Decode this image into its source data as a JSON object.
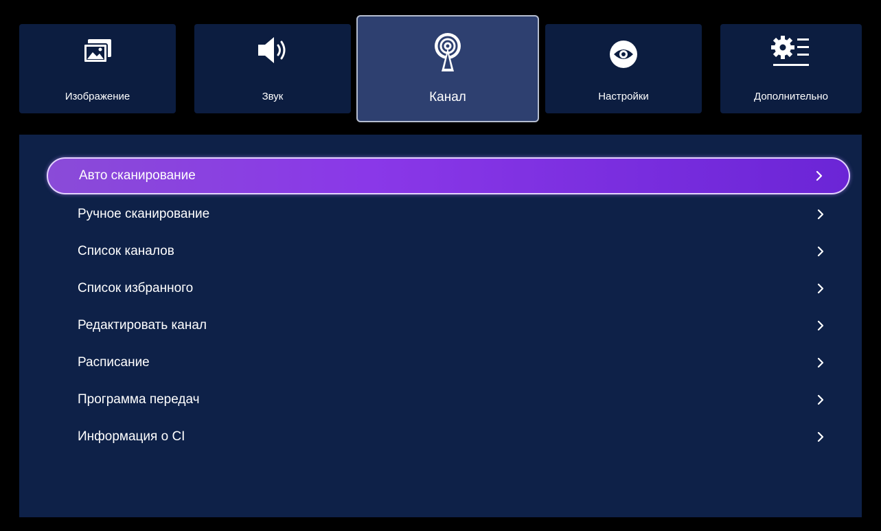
{
  "tabs": [
    {
      "label": "Изображение",
      "icon": "picture-icon"
    },
    {
      "label": "Звук",
      "icon": "speaker-icon"
    },
    {
      "label": "Канал",
      "icon": "antenna-icon",
      "active": true
    },
    {
      "label": "Настройки",
      "icon": "eye-icon"
    },
    {
      "label": "Дополнительно",
      "icon": "gear-list-icon"
    }
  ],
  "menu": {
    "items": [
      {
        "label": "Авто сканирование",
        "selected": true
      },
      {
        "label": "Ручное сканирование"
      },
      {
        "label": "Список каналов"
      },
      {
        "label": "Список избранного"
      },
      {
        "label": "Редактировать канал"
      },
      {
        "label": "Расписание"
      },
      {
        "label": "Программа передач"
      },
      {
        "label": "Информация о CI"
      }
    ]
  },
  "colors": {
    "background": "#000000",
    "tab_background": "#0c1d40",
    "tab_active_background": "#2e4070",
    "panel_background": "#0e2148",
    "selected_gradient_start": "#8a4bd8",
    "selected_gradient_end": "#6b25d6",
    "text": "#ffffff"
  }
}
